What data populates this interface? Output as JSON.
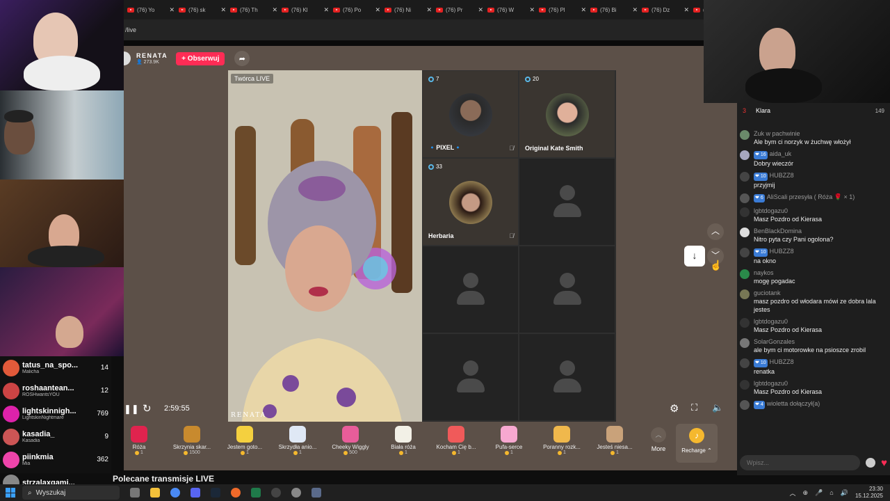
{
  "browser": {
    "tabs": [
      "(76) Yo",
      "(76) sk",
      "(76) Th",
      "(76) Kl",
      "(76) Po",
      "(76) Ni",
      "(76) Pr",
      "(76) W",
      "(76) Pl",
      "(76) Bi",
      "(76) Dz",
      "(76) G"
    ],
    "url": "/live"
  },
  "host": {
    "name": "RENATA",
    "followers": "273.9K",
    "follow_label": "+ Obserwuj"
  },
  "video": {
    "badge": "Twórca LIVE",
    "watermark": "RENATA",
    "time": "2:59:55"
  },
  "guests": [
    {
      "count": "7",
      "name": "PIXEL"
    },
    {
      "count": "20",
      "name": "Original Kate Smith"
    },
    {
      "count": "33",
      "name": "Herbaria"
    }
  ],
  "gifts": [
    {
      "name": "Róża",
      "price": "1",
      "color": "#e0234e"
    },
    {
      "name": "Skrzynia skar...",
      "price": "1500",
      "color": "#c88a2e"
    },
    {
      "name": "Jestem goto...",
      "price": "1",
      "color": "#f4d03f"
    },
    {
      "name": "Skrzydła anio...",
      "price": "1",
      "color": "#dfe8f5"
    },
    {
      "name": "Cheeky Wiggly",
      "price": "500",
      "color": "#e85d9a"
    },
    {
      "name": "Biała róża",
      "price": "1",
      "color": "#f2f0e6"
    },
    {
      "name": "Kocham Cię b...",
      "price": "1",
      "color": "#f05a5a"
    },
    {
      "name": "Pufa-serce",
      "price": "1",
      "color": "#f7a8d0"
    },
    {
      "name": "Poranny rozk...",
      "price": "1",
      "color": "#f0b84c"
    },
    {
      "name": "Jesteś niesa...",
      "price": "1",
      "color": "#c9a27a"
    }
  ],
  "more_label": "More",
  "recharge_label": "Recharge",
  "recommended": "Polecane transmisje LIVE",
  "chat": {
    "top_user": "Klara",
    "top_count": "149",
    "messages": [
      {
        "nick": "Zuk w pachwinie",
        "level": "",
        "text": "Ale bym ci norzyk w żuchwę włożył"
      },
      {
        "nick": "aida_uk",
        "level": "16",
        "text": "Dobry wieczór"
      },
      {
        "nick": "HUBZZ8",
        "level": "10",
        "text": "przyjmij"
      },
      {
        "nick": "AliScali przesyła ( Róża 🌹 × 1)",
        "level": "6",
        "text": ""
      },
      {
        "nick": "lgbtdogazu0",
        "level": "",
        "text": "Masz Pozdro od Kierasa"
      },
      {
        "nick": "BenBlackDomina",
        "level": "",
        "text": "Nitro pyta czy Pani ogolona?"
      },
      {
        "nick": "HUBZZ8",
        "level": "10",
        "text": "na okno"
      },
      {
        "nick": "naykos",
        "level": "",
        "text": "mogę pogadac"
      },
      {
        "nick": "guciotank",
        "level": "",
        "text": "masz pozdro od włodara mówi ze dobra lala jestes"
      },
      {
        "nick": "lgbtdogazu0",
        "level": "",
        "text": "Masz Pozdro od Kierasa"
      },
      {
        "nick": "SolarGonzales",
        "level": "",
        "text": "ale bym ci motorowke na psioszce zrobil"
      },
      {
        "nick": "HUBZZ8",
        "level": "10",
        "text": "renatka"
      },
      {
        "nick": "lgbtdogazu0",
        "level": "",
        "text": "Masz Pozdro od Kierasa"
      },
      {
        "nick": "wioletta dołączył(a)",
        "level": "4",
        "text": ""
      }
    ],
    "input_placeholder": "Wpisz..."
  },
  "viewers": [
    {
      "name": "tatus_na_spo...",
      "sub": "Malicha",
      "count": "14",
      "color": "#e25a3a"
    },
    {
      "name": "roshaantean...",
      "sub": "ROSHwantsYOU",
      "count": "12",
      "color": "#c44"
    },
    {
      "name": "lightskinnigh...",
      "sub": "LightskinNightmare",
      "count": "769",
      "color": "#d2a"
    },
    {
      "name": "kasadia_",
      "sub": "Kasadia",
      "count": "9",
      "color": "#c55"
    },
    {
      "name": "piinkmia",
      "sub": "Mia",
      "count": "362",
      "color": "#e4a"
    },
    {
      "name": "strzalaxgami...",
      "sub": "",
      "count": "",
      "color": "#888"
    }
  ],
  "taskbar": {
    "search": "Wyszukaj",
    "time": "23:30",
    "date": "15.12.2025"
  }
}
